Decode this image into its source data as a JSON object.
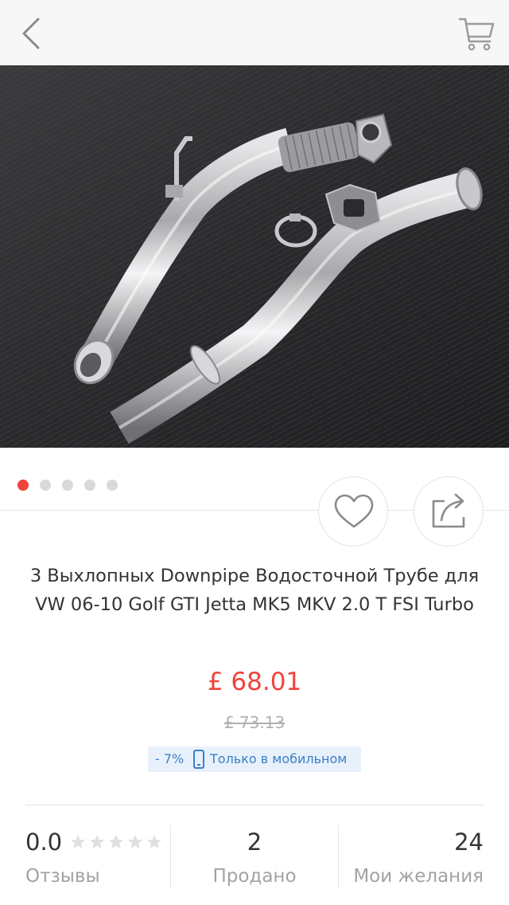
{
  "header": {
    "back_icon": "chevron-left-icon",
    "cart_icon": "shopping-cart-icon"
  },
  "gallery": {
    "image_count": 5,
    "active_index": 0,
    "active_dot_color": "#f0433a",
    "inactive_dot_color": "#d9d9d9"
  },
  "actions": {
    "wishlist_icon": "heart-icon",
    "share_icon": "share-icon"
  },
  "product": {
    "title": "3 Выхлопных Downpipe Водосточной Трубе для VW 06-10 Golf GTI Jetta MK5 MKV 2.0 T FSI Turbo",
    "price": "£ 68.01",
    "old_price": "£ 73.13",
    "price_color": "#f0433a"
  },
  "promo": {
    "discount": "- 7%",
    "icon": "mobile-phone-icon",
    "text": "Только в мобильном"
  },
  "stats": {
    "rating_value": "0.0",
    "rating_stars": 0,
    "rating_stars_max": 5,
    "reviews_label": "Отзывы",
    "sold_value": "2",
    "sold_label": "Продано",
    "wishes_value": "24",
    "wishes_label": "Мои желания"
  }
}
